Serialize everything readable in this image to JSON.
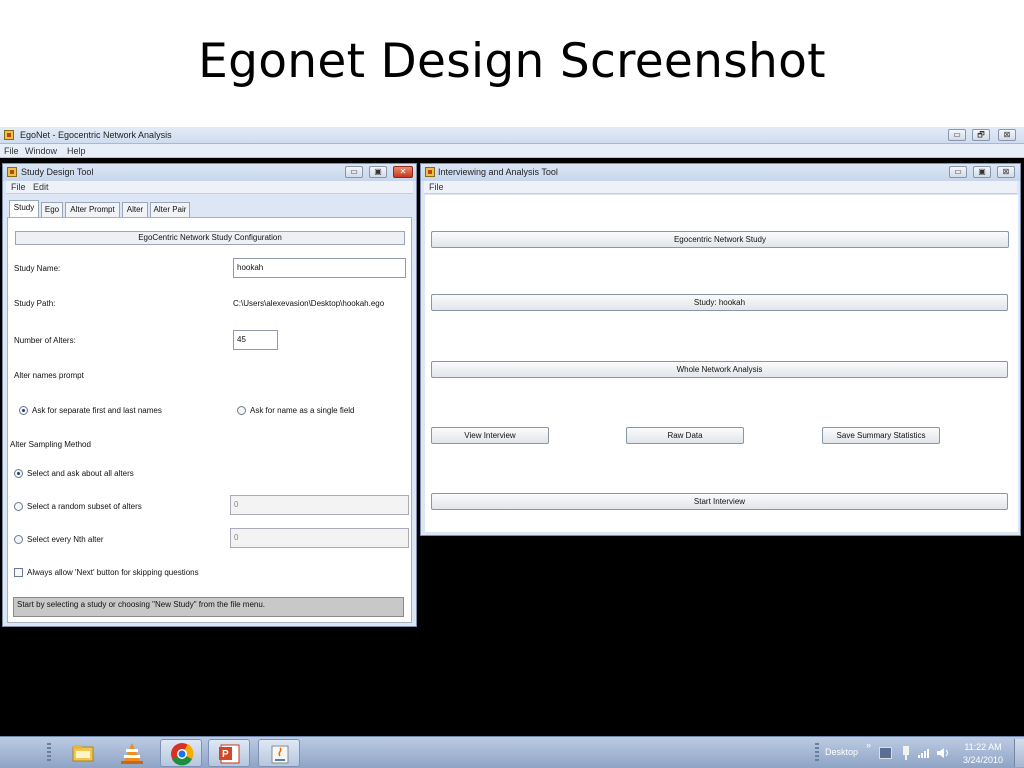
{
  "slide": {
    "title": "Egonet Design Screenshot"
  },
  "app": {
    "title": "EgoNet - Egocentric Network Analysis",
    "menu": [
      "File",
      "Window",
      "Help"
    ],
    "controls": {
      "minimize": "▭",
      "restore": "🗗",
      "close": "⊠"
    }
  },
  "study_window": {
    "title": "Study Design Tool",
    "controls": {
      "minimize": "▭",
      "maximize": "▣",
      "close": "✕"
    },
    "menu": [
      "File",
      "Edit"
    ],
    "tabs": [
      "Study",
      "Ego",
      "Alter Prompt",
      "Alter",
      "Alter Pair"
    ],
    "active_tab": "Study",
    "header": "EgoCentric Network Study Configuration",
    "study_name_label": "Study Name:",
    "study_name_value": "hookah",
    "study_path_label": "Study Path:",
    "study_path_value": "C:\\Users\\alexevasion\\Desktop\\hookah.ego",
    "num_alters_label": "Number of Alters:",
    "num_alters_value": "45",
    "alter_names_label": "Alter names prompt",
    "radio_separate": "Ask for separate first and last names",
    "radio_single": "Ask for name as a single field",
    "sampling_label": "Alter Sampling Method",
    "sampling_all": "Select and ask about all alters",
    "sampling_random": "Select a random subset of alters",
    "sampling_random_value": "0",
    "sampling_nth": "Select every Nth alter",
    "sampling_nth_value": "0",
    "always_next": "Always allow 'Next' button for skipping questions",
    "status": "Start by selecting a study or choosing \"New Study\" from the file menu."
  },
  "interview_window": {
    "title": "Interviewing and Analysis Tool",
    "controls": {
      "minimize": "▭",
      "maximize": "▣",
      "close": "⊠"
    },
    "menu": [
      "File"
    ],
    "egocentric_study": "Egocentric Network Study",
    "study_button": "Study: hookah",
    "whole_network": "Whole Network Analysis",
    "view_interview": "View Interview",
    "raw_data": "Raw Data",
    "save_summary": "Save Summary Statistics",
    "start_interview": "Start Interview"
  },
  "taskbar": {
    "desktop_label": "Desktop",
    "overflow": "»",
    "time": "11:22 AM",
    "date": "3/24/2010",
    "apps": [
      "file-explorer",
      "vlc",
      "chrome",
      "powerpoint",
      "java"
    ],
    "colors": {
      "accent": "#1c5fa8",
      "vlc": "#f28c1a",
      "powerpoint": "#d24726"
    }
  }
}
